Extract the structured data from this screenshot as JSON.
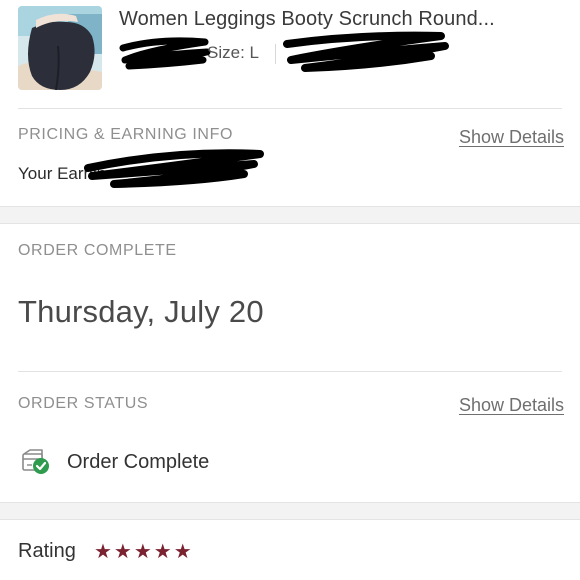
{
  "product": {
    "title": "Women Leggings Booty Scrunch Round...",
    "size_label": "Size: L",
    "thumbnail_icon": "product-photo-leggings"
  },
  "pricing": {
    "section_label": "PRICING & EARNING INFO",
    "show_details": "Show Details",
    "earnings_text": "Your Earnin"
  },
  "order_complete": {
    "section_label": "ORDER COMPLETE",
    "date": "Thursday, July 20"
  },
  "order_status": {
    "section_label": "ORDER STATUS",
    "show_details": "Show Details",
    "status_text": "Order Complete",
    "status_icon": "box-check-icon",
    "check_color": "#2e9b4e"
  },
  "rating": {
    "label": "Rating",
    "stars": 5,
    "stars_text": "★★★★★",
    "star_color": "#7a2230"
  }
}
